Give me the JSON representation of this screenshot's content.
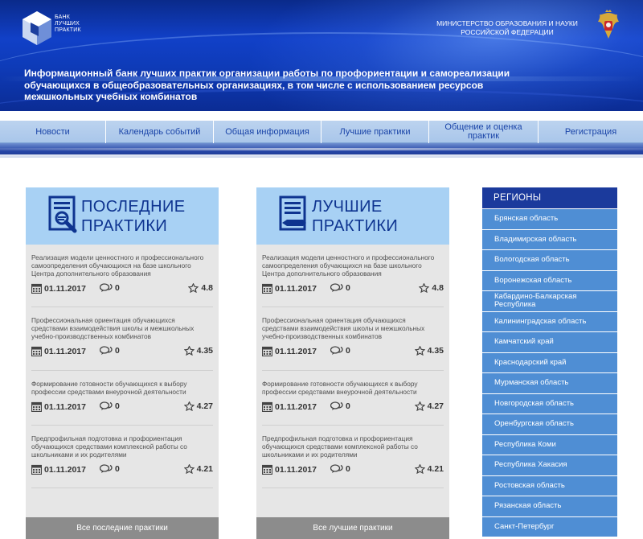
{
  "header": {
    "logo_text": [
      "БАНК",
      "ЛУЧШИХ",
      "ПРАКТИК"
    ],
    "ministry": [
      "МИНИСТЕРСТВО ОБРАЗОВАНИЯ И НАУКИ",
      "РОССИЙСКОЙ ФЕДЕРАЦИИ"
    ],
    "title": "Информационный банк лучших практик организации работы по профориентации и самореализации обучающихся в общеобразовательных организациях, в том числе с использованием ресурсов межшкольных учебных комбинатов"
  },
  "nav": [
    {
      "label": "Новости"
    },
    {
      "label": "Календарь событий"
    },
    {
      "label": "Общая информация"
    },
    {
      "label": "Лучшие практики"
    },
    {
      "label": "Общение и оценка практик"
    },
    {
      "label": "Регистрация"
    }
  ],
  "latest": {
    "title_line1": "ПОСЛЕДНИЕ",
    "title_line2": "ПРАКТИКИ",
    "footer": "Все последние практики",
    "items": [
      {
        "text": "Реализация модели ценностного и профессионального самоопределения обучающихся на базе школьного Центра дополнительного образования",
        "date": "01.11.2017",
        "comments": "0",
        "rating": "4.8"
      },
      {
        "text": "Профессиональная ориентация обучающихся средствами взаимодействия школы и межшкольных учебно-производственных комбинатов",
        "date": "01.11.2017",
        "comments": "0",
        "rating": "4.35"
      },
      {
        "text": "Формирование готовности обучающихся к выбору профессии средствами внеурочной деятельности",
        "date": "01.11.2017",
        "comments": "0",
        "rating": "4.27"
      },
      {
        "text": "Предпрофильная подготовка и профориентация обучающихся средствами комплексной работы со школьниками и их родителями",
        "date": "01.11.2017",
        "comments": "0",
        "rating": "4.21"
      }
    ]
  },
  "best": {
    "title_line1": "ЛУЧШИЕ",
    "title_line2": "ПРАКТИКИ",
    "footer": "Все лучшие практики",
    "items": [
      {
        "text": "Реализация модели ценностного и профессионального самоопределения обучающихся на базе школьного Центра дополнительного образования",
        "date": "01.11.2017",
        "comments": "0",
        "rating": "4.8"
      },
      {
        "text": "Профессиональная ориентация обучающихся средствами взаимодействия школы и межшкольных учебно-производственных комбинатов",
        "date": "01.11.2017",
        "comments": "0",
        "rating": "4.35"
      },
      {
        "text": "Формирование готовности обучающихся к выбору профессии средствами внеурочной деятельности",
        "date": "01.11.2017",
        "comments": "0",
        "rating": "4.27"
      },
      {
        "text": "Предпрофильная подготовка и профориентация обучающихся средствами комплексной работы со школьниками и их родителями",
        "date": "01.11.2017",
        "comments": "0",
        "rating": "4.21"
      }
    ]
  },
  "regions": {
    "title": "РЕГИОНЫ",
    "items": [
      "Брянская область",
      "Владимирская область",
      "Вологодская область",
      "Воронежская область",
      "Кабардино-Балкарская Республика",
      "Калининградская область",
      "Камчатский край",
      "Краснодарский край",
      "Мурманская область",
      "Новгородская область",
      "Оренбургская область",
      "Республика Коми",
      "Республика Хакасия",
      "Ростовская область",
      "Рязанская область",
      "Санкт-Петербург"
    ]
  },
  "colors": {
    "header_blue": "#1140c8",
    "nav_bg": "#a9c6ea",
    "nav_text": "#1a44a8",
    "panel_head": "#a8d1f4",
    "panel_title": "#0e3490",
    "region_bg": "#4f8ed4",
    "region_head": "#1b3a9c",
    "footer_gray": "#8c8c8c"
  }
}
